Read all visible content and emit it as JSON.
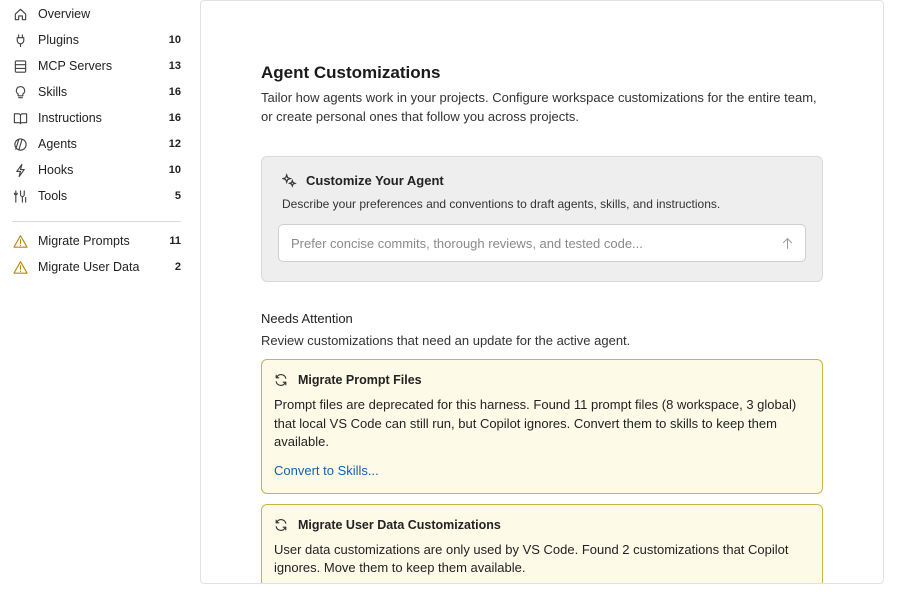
{
  "sidebar": {
    "items": [
      {
        "label": "Overview",
        "count": "",
        "icon": "home-icon"
      },
      {
        "label": "Plugins",
        "count": "10",
        "icon": "plug-icon"
      },
      {
        "label": "MCP Servers",
        "count": "13",
        "icon": "server-icon"
      },
      {
        "label": "Skills",
        "count": "16",
        "icon": "lightbulb-icon"
      },
      {
        "label": "Instructions",
        "count": "16",
        "icon": "book-icon"
      },
      {
        "label": "Agents",
        "count": "12",
        "icon": "agent-icon"
      },
      {
        "label": "Hooks",
        "count": "10",
        "icon": "lightning-icon"
      },
      {
        "label": "Tools",
        "count": "5",
        "icon": "tools-icon"
      }
    ],
    "warnings": [
      {
        "label": "Migrate Prompts",
        "count": "11",
        "icon": "warning-icon"
      },
      {
        "label": "Migrate User Data",
        "count": "2",
        "icon": "warning-icon"
      }
    ]
  },
  "main": {
    "title": "Agent Customizations",
    "description": "Tailor how agents work in your projects. Configure workspace customizations for the entire team, or create personal ones that follow you across projects.",
    "customize": {
      "title": "Customize Your Agent",
      "subtitle": "Describe your preferences and conventions to draft agents, skills, and instructions.",
      "placeholder": "Prefer concise commits, thorough reviews, and tested code..."
    },
    "attention": {
      "heading": "Needs Attention",
      "subheading": "Review customizations that need an update for the active agent.",
      "cards": [
        {
          "title": "Migrate Prompt Files",
          "body": "Prompt files are deprecated for this harness. Found 11 prompt files (8 workspace, 3 global) that local VS Code can still run, but Copilot ignores. Convert them to skills to keep them available.",
          "link": "Convert to Skills..."
        },
        {
          "title": "Migrate User Data Customizations",
          "body": "User data customizations are only used by VS Code. Found 2 customizations that Copilot ignores. Move them to keep them available."
        }
      ]
    }
  },
  "colors": {
    "alert_bg": "#fdfbe8",
    "alert_border": "#c9b44a",
    "link": "#0f62b3",
    "warning": "#b8860b"
  }
}
